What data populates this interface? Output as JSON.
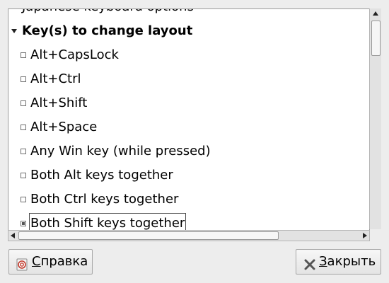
{
  "list": {
    "partial_row": "Japanese keyboard options",
    "group": "Key(s) to change layout",
    "options": [
      {
        "label": "Alt+CapsLock",
        "checked": false
      },
      {
        "label": "Alt+Ctrl",
        "checked": false
      },
      {
        "label": "Alt+Shift",
        "checked": false
      },
      {
        "label": "Alt+Space",
        "checked": false
      },
      {
        "label": "Any Win key (while pressed)",
        "checked": false
      },
      {
        "label": "Both Alt keys together",
        "checked": false
      },
      {
        "label": "Both Ctrl keys together",
        "checked": false
      },
      {
        "label": "Both Shift keys together",
        "checked": true
      }
    ]
  },
  "buttons": {
    "help": {
      "mnemonic": "С",
      "rest": "правка",
      "icon": "help-icon"
    },
    "close": {
      "mnemonic": "З",
      "rest": "акрыть",
      "icon": "close-icon"
    }
  }
}
